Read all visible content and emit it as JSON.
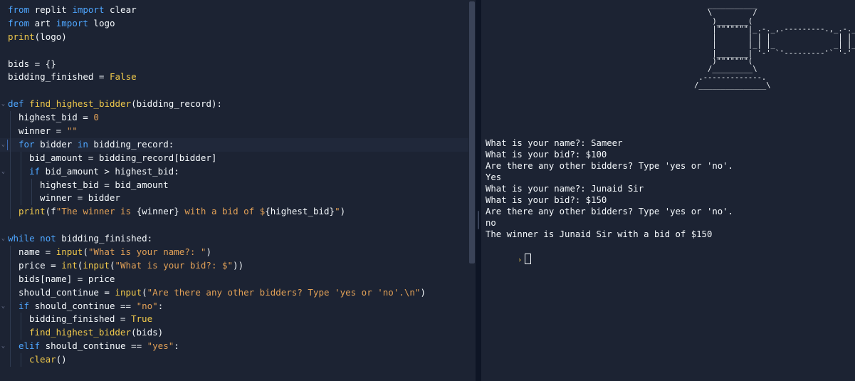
{
  "editor": {
    "lines": [
      {
        "indent": 0,
        "fold": "",
        "active": false,
        "tokens": [
          {
            "t": "from",
            "c": "kw"
          },
          {
            "t": " replit "
          },
          {
            "t": "import",
            "c": "kw"
          },
          {
            "t": " clear"
          }
        ]
      },
      {
        "indent": 0,
        "fold": "",
        "active": false,
        "tokens": [
          {
            "t": "from",
            "c": "kw"
          },
          {
            "t": " art "
          },
          {
            "t": "import",
            "c": "kw"
          },
          {
            "t": " logo"
          }
        ]
      },
      {
        "indent": 0,
        "fold": "",
        "active": false,
        "tokens": [
          {
            "t": "print",
            "c": "fn"
          },
          {
            "t": "(logo)"
          }
        ]
      },
      {
        "indent": 0,
        "fold": "",
        "active": false,
        "tokens": []
      },
      {
        "indent": 0,
        "fold": "",
        "active": false,
        "tokens": [
          {
            "t": "bids = {}"
          }
        ]
      },
      {
        "indent": 0,
        "fold": "",
        "active": false,
        "tokens": [
          {
            "t": "bidding_finished = "
          },
          {
            "t": "False",
            "c": "bool"
          }
        ]
      },
      {
        "indent": 0,
        "fold": "",
        "active": false,
        "tokens": []
      },
      {
        "indent": 0,
        "fold": "⌄",
        "active": false,
        "tokens": [
          {
            "t": "def",
            "c": "kw"
          },
          {
            "t": " "
          },
          {
            "t": "find_highest_bidder",
            "c": "fn"
          },
          {
            "t": "(bidding_record):"
          }
        ]
      },
      {
        "indent": 1,
        "fold": "",
        "active": false,
        "tokens": [
          {
            "t": "highest_bid = "
          },
          {
            "t": "0",
            "c": "num"
          }
        ]
      },
      {
        "indent": 1,
        "fold": "",
        "active": false,
        "tokens": [
          {
            "t": "winner = "
          },
          {
            "t": "\"\"",
            "c": "str"
          }
        ]
      },
      {
        "indent": 1,
        "fold": "⌄",
        "active": true,
        "tokens": [
          {
            "t": "for",
            "c": "kw"
          },
          {
            "t": " bidder "
          },
          {
            "t": "in",
            "c": "kw"
          },
          {
            "t": " bidding_record:"
          }
        ]
      },
      {
        "indent": 2,
        "fold": "",
        "active": false,
        "tokens": [
          {
            "t": "bid_amount = bidding_record[bidder]"
          }
        ]
      },
      {
        "indent": 2,
        "fold": "⌄",
        "active": false,
        "tokens": [
          {
            "t": "if",
            "c": "kw"
          },
          {
            "t": " bid_amount > highest_bid:"
          }
        ]
      },
      {
        "indent": 3,
        "fold": "",
        "active": false,
        "tokens": [
          {
            "t": "highest_bid = bid_amount"
          }
        ]
      },
      {
        "indent": 3,
        "fold": "",
        "active": false,
        "tokens": [
          {
            "t": "winner = bidder"
          }
        ]
      },
      {
        "indent": 1,
        "fold": "",
        "active": false,
        "tokens": [
          {
            "t": "print",
            "c": "fn"
          },
          {
            "t": "(f"
          },
          {
            "t": "\"The winner is ",
            "c": "str"
          },
          {
            "t": "{winner}"
          },
          {
            "t": " with a bid of $",
            "c": "str"
          },
          {
            "t": "{highest_bid}"
          },
          {
            "t": "\"",
            "c": "str"
          },
          {
            "t": ")"
          }
        ]
      },
      {
        "indent": 0,
        "fold": "",
        "active": false,
        "tokens": []
      },
      {
        "indent": 0,
        "fold": "⌄",
        "active": false,
        "tokens": [
          {
            "t": "while",
            "c": "kw"
          },
          {
            "t": " "
          },
          {
            "t": "not",
            "c": "kw"
          },
          {
            "t": " bidding_finished:"
          }
        ]
      },
      {
        "indent": 1,
        "fold": "",
        "active": false,
        "tokens": [
          {
            "t": "name = "
          },
          {
            "t": "input",
            "c": "fn"
          },
          {
            "t": "("
          },
          {
            "t": "\"What is your name?: \"",
            "c": "str"
          },
          {
            "t": ")"
          }
        ]
      },
      {
        "indent": 1,
        "fold": "",
        "active": false,
        "tokens": [
          {
            "t": "price = "
          },
          {
            "t": "int",
            "c": "fn"
          },
          {
            "t": "("
          },
          {
            "t": "input",
            "c": "fn"
          },
          {
            "t": "("
          },
          {
            "t": "\"What is your bid?: $\"",
            "c": "str"
          },
          {
            "t": "))"
          }
        ]
      },
      {
        "indent": 1,
        "fold": "",
        "active": false,
        "tokens": [
          {
            "t": "bids[name] = price"
          }
        ]
      },
      {
        "indent": 1,
        "fold": "",
        "active": false,
        "tokens": [
          {
            "t": "should_continue = "
          },
          {
            "t": "input",
            "c": "fn"
          },
          {
            "t": "("
          },
          {
            "t": "\"Are there any other bidders? Type 'yes or 'no'.\\n\"",
            "c": "str"
          },
          {
            "t": ")"
          }
        ]
      },
      {
        "indent": 1,
        "fold": "⌄",
        "active": false,
        "tokens": [
          {
            "t": "if",
            "c": "kw"
          },
          {
            "t": " should_continue == "
          },
          {
            "t": "\"no\"",
            "c": "str"
          },
          {
            "t": ":"
          }
        ]
      },
      {
        "indent": 2,
        "fold": "",
        "active": false,
        "tokens": [
          {
            "t": "bidding_finished = "
          },
          {
            "t": "True",
            "c": "bool"
          }
        ]
      },
      {
        "indent": 2,
        "fold": "",
        "active": false,
        "tokens": [
          {
            "t": "find_highest_bidder",
            "c": "fn"
          },
          {
            "t": "(bids)"
          }
        ]
      },
      {
        "indent": 1,
        "fold": "⌄",
        "active": false,
        "tokens": [
          {
            "t": "elif",
            "c": "kw"
          },
          {
            "t": " should_continue == "
          },
          {
            "t": "\"yes\"",
            "c": "str"
          },
          {
            "t": ":"
          }
        ]
      },
      {
        "indent": 2,
        "fold": "",
        "active": false,
        "tokens": [
          {
            "t": "clear",
            "c": "fn"
          },
          {
            "t": "()"
          }
        ]
      }
    ]
  },
  "console": {
    "logo": "                         ___________\n                         \\         /\n                          )_______(\n                          |\"\"\"\"\"\"\"|_.-._,.---------.,_.-._\n                          |       | | |               | | ''-.\n                          |       |_| |_             _| |_..-'\n                          |_______| '-' `'---------'` '-'\n                          )\"\"\"\"\"\"\"(\n                         /_________\\\n                       .-------------.\n                      /_______________\\",
    "output": [
      "What is your name?: Sameer",
      "What is your bid?: $100",
      "Are there any other bidders? Type 'yes or 'no'.",
      "Yes",
      "What is your name?: Junaid Sir",
      "What is your bid?: $150",
      "Are there any other bidders? Type 'yes or 'no'.",
      "no",
      "The winner is Junaid Sir with a bid of $150"
    ],
    "prompt_symbol": "›"
  },
  "colors": {
    "background": "#1c2333",
    "keyword": "#4ea6ff",
    "function": "#f0c94b",
    "string": "#e2a157",
    "text": "#f5f9fc"
  }
}
